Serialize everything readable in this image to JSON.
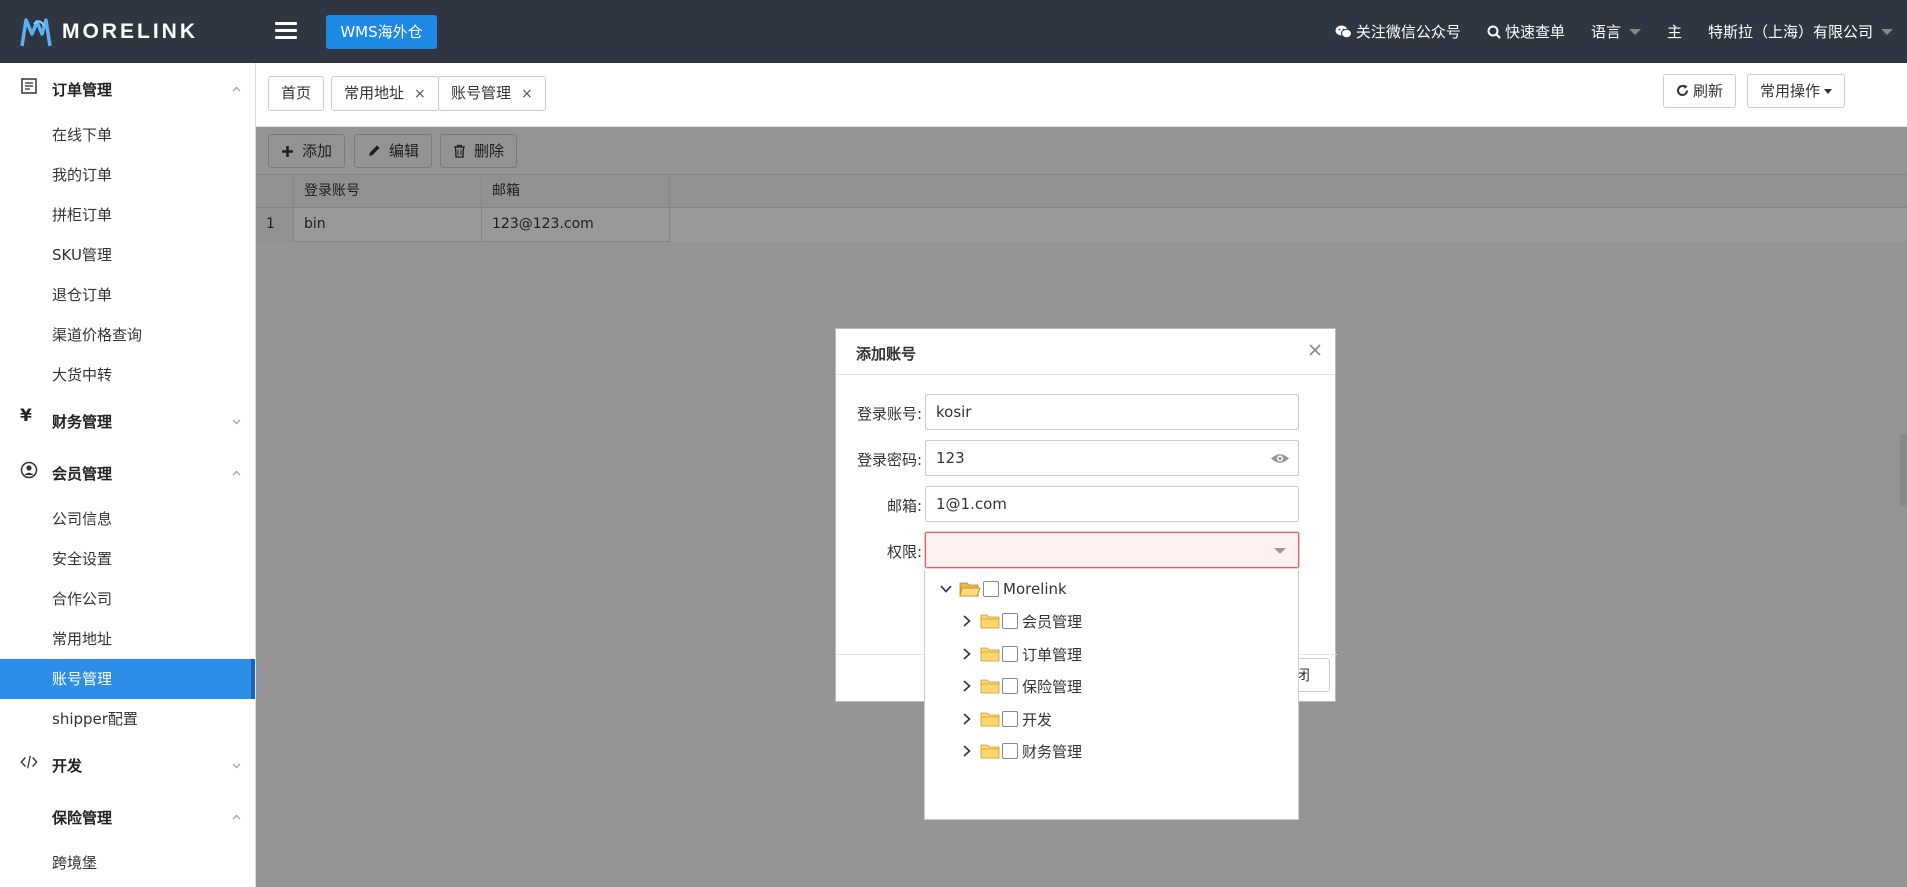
{
  "header": {
    "logo_text": "MORELINK",
    "wms_button": "WMS海外仓",
    "wechat": "关注微信公众号",
    "quick_search": "快速查单",
    "language": "语言",
    "user_role": "主",
    "company": "特斯拉（上海）有限公司"
  },
  "sidebar": {
    "groups": [
      {
        "label": "订单管理",
        "icon": "order-icon",
        "expanded": true,
        "items": [
          "在线下单",
          "我的订单",
          "拼柜订单",
          "SKU管理",
          "退仓订单",
          "渠道价格查询",
          "大货中转"
        ]
      },
      {
        "label": "财务管理",
        "icon": "yen-icon",
        "expanded": false,
        "items": []
      },
      {
        "label": "会员管理",
        "icon": "user-icon",
        "expanded": true,
        "items": [
          "公司信息",
          "安全设置",
          "合作公司",
          "常用地址",
          "账号管理",
          "shipper配置"
        ]
      },
      {
        "label": "开发",
        "icon": "code-icon",
        "expanded": false,
        "items": []
      },
      {
        "label": "保险管理",
        "icon": "none",
        "expanded": true,
        "items": [
          "跨境堡"
        ]
      }
    ],
    "active_item": "账号管理"
  },
  "tabs": [
    {
      "label": "首页",
      "closable": false
    },
    {
      "label": "常用地址",
      "closable": true
    },
    {
      "label": "账号管理",
      "closable": true
    }
  ],
  "tab_close_glyph": "×",
  "toolbar_right": {
    "refresh": "刷新",
    "common_ops": "常用操作"
  },
  "toolbar": {
    "add": "添加",
    "edit": "编辑",
    "delete": "删除"
  },
  "grid": {
    "columns": [
      "登录账号",
      "邮箱"
    ],
    "rows": [
      {
        "index": "1",
        "account": "bin",
        "email": "123@123.com"
      }
    ]
  },
  "modal": {
    "title": "添加账号",
    "fields": {
      "account_label": "登录账号:",
      "account_value": "kosir",
      "password_label": "登录密码:",
      "password_value": "123",
      "email_label": "邮箱:",
      "email_value": "1@1.com",
      "permission_label": "权限:",
      "permission_value": ""
    },
    "close_button_partial": "闭"
  },
  "tree": {
    "root": "Morelink",
    "children": [
      "会员管理",
      "订单管理",
      "保险管理",
      "开发",
      "财务管理"
    ]
  },
  "colors": {
    "topbar": "#2f3541",
    "accent": "#1e88e5",
    "active_item": "#2d8ee8",
    "error_border": "#ee5555"
  }
}
